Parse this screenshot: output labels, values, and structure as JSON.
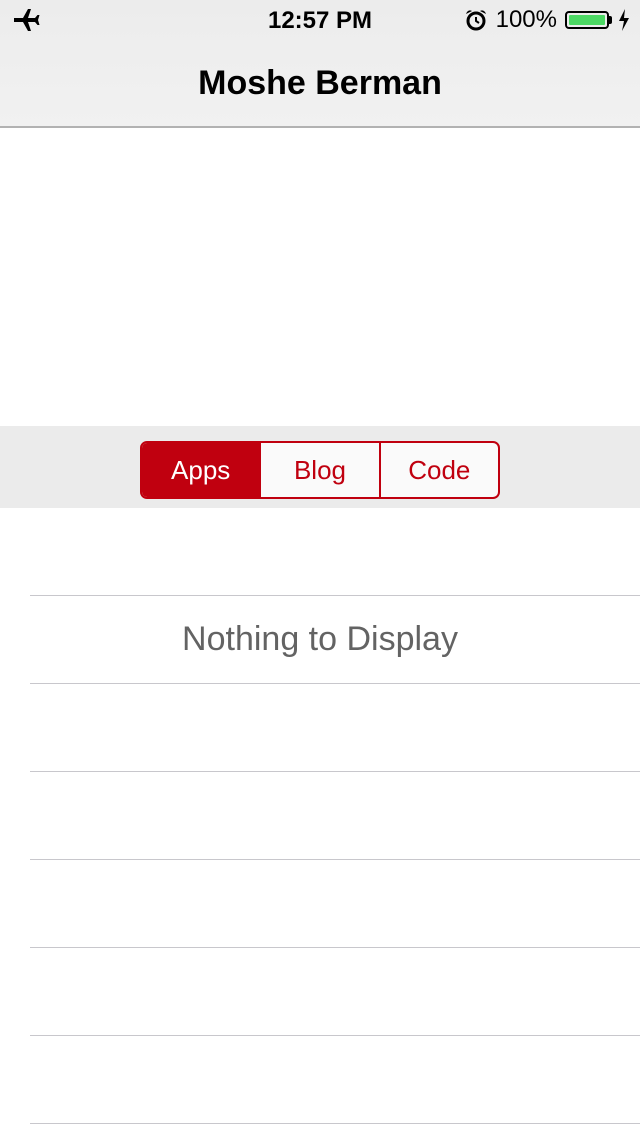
{
  "status_bar": {
    "left_icon": "airplane-icon",
    "time": "12:57 PM",
    "alarm_icon": "alarm-clock-icon",
    "battery_percent": "100%",
    "battery_level": 1.0,
    "battery_color": "#4cd964",
    "charging_icon": "bolt-icon"
  },
  "nav": {
    "title": "Moshe Berman"
  },
  "segments": {
    "accent_color": "#c0000f",
    "items": [
      {
        "label": "Apps",
        "selected": true
      },
      {
        "label": "Blog",
        "selected": false
      },
      {
        "label": "Code",
        "selected": false
      }
    ]
  },
  "table": {
    "empty_message": "Nothing to Display"
  }
}
